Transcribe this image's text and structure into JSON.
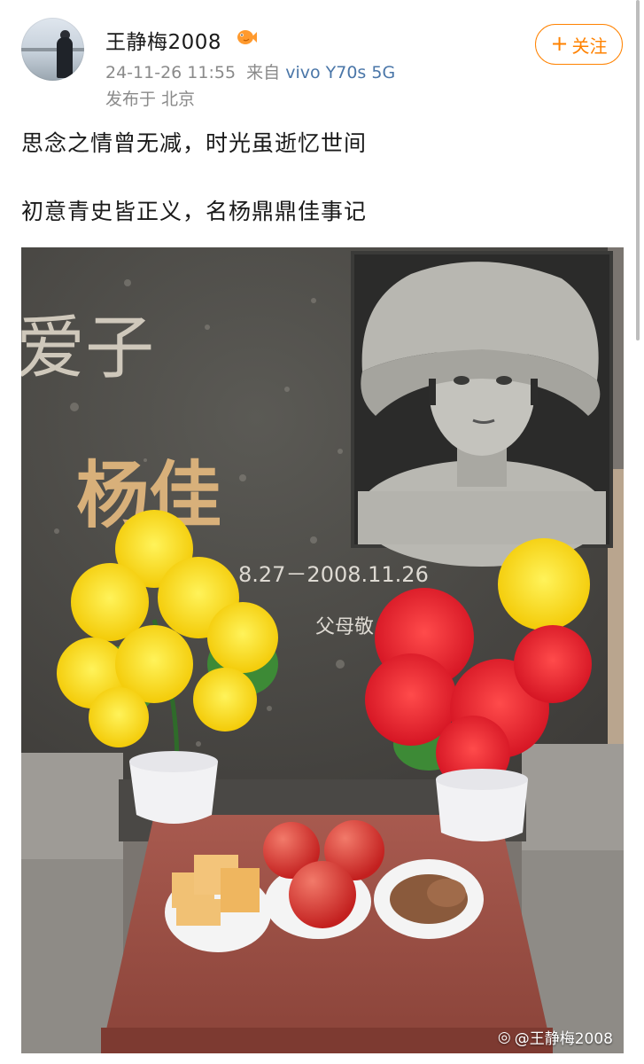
{
  "post": {
    "username": "王静梅2008",
    "timestamp": "24-11-26 11:55",
    "source_prefix": "来自",
    "device": "vivo Y70s 5G",
    "location": "发布于 北京",
    "follow_label": "关注",
    "text_lines": [
      "思念之情曾无减，时光虽逝忆世间",
      "初意青史皆正义，名杨鼎鼎佳事记"
    ]
  },
  "photo": {
    "inscription_title": "爱子",
    "inscription_name": "杨佳",
    "inscription_dates": "8.27－2008.11.26",
    "inscription_parents": "父母敬",
    "watermark": "@王静梅2008"
  }
}
